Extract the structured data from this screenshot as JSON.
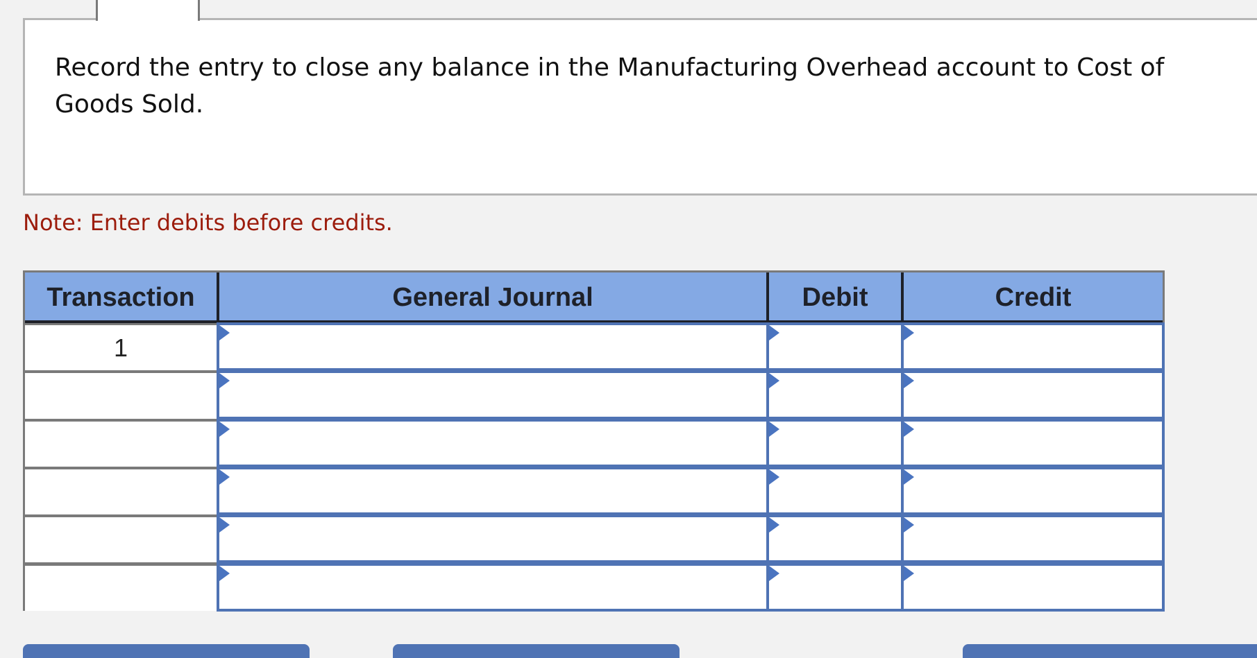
{
  "question": {
    "text": "Record the entry to close any balance in the Manufacturing Overhead account to Cost of Goods Sold."
  },
  "note": "Note: Enter debits before credits.",
  "journal": {
    "headers": [
      "Transaction",
      "General Journal",
      "Debit",
      "Credit"
    ],
    "rows": [
      {
        "transaction": "1",
        "account": "",
        "debit": "",
        "credit": ""
      },
      {
        "transaction": "",
        "account": "",
        "debit": "",
        "credit": ""
      },
      {
        "transaction": "",
        "account": "",
        "debit": "",
        "credit": ""
      },
      {
        "transaction": "",
        "account": "",
        "debit": "",
        "credit": ""
      },
      {
        "transaction": "",
        "account": "",
        "debit": "",
        "credit": ""
      },
      {
        "transaction": "",
        "account": "",
        "debit": "",
        "credit": ""
      }
    ]
  },
  "colors": {
    "header_bg": "#84a9e4",
    "input_border": "#4f73b4",
    "note_text": "#9c1c0c",
    "button_bg": "#4f73b4"
  }
}
